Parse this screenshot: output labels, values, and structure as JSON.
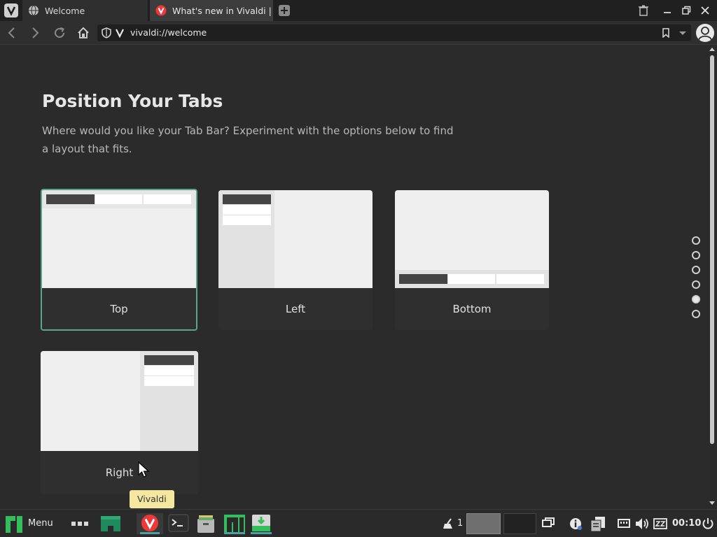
{
  "browser": {
    "tabs": [
      {
        "title": "Welcome",
        "active": false
      },
      {
        "title": "What's new in Vivaldi | Viva",
        "active": true
      }
    ],
    "address": {
      "url": "vivaldi://welcome"
    }
  },
  "page": {
    "title": "Position Your Tabs",
    "subtitle": "Where would you like your Tab Bar? Experiment with the options below to find a layout that fits.",
    "options": [
      {
        "label": "Top",
        "selected": true
      },
      {
        "label": "Left",
        "selected": false
      },
      {
        "label": "Bottom",
        "selected": false
      },
      {
        "label": "Right",
        "selected": false
      }
    ],
    "steps": {
      "count": 6,
      "active_index": 4
    }
  },
  "taskbar": {
    "menu_label": "Menu",
    "tooltip": "Vivaldi",
    "notification_count": "1",
    "clock": "00:10"
  },
  "colors": {
    "accent": "#5aa88a",
    "vivaldi_red": "#ef3939",
    "tooltip": "#f5e7a0"
  }
}
